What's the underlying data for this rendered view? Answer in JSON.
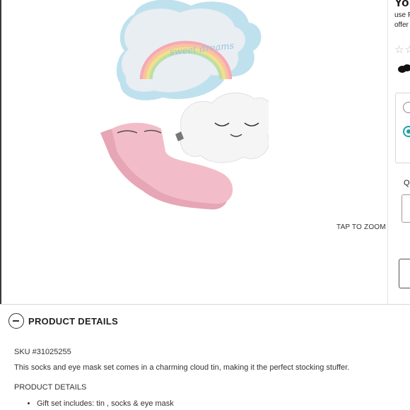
{
  "gallery": {
    "tin_lid_text": "sweet dreams",
    "tap_to_zoom": "TAP TO ZOOM"
  },
  "summary": {
    "title": "Yo",
    "line1": "use F",
    "line2": "offer",
    "stars": "☆☆",
    "qty_label": "Q"
  },
  "details": {
    "header": "PRODUCT DETAILS",
    "sku": "SKU #31025255",
    "description": "This socks and eye mask set comes in a charming cloud tin, making it the perfect stocking stuffer.",
    "subheader": "PRODUCT DETAILS",
    "bullets": [
      "Gift set includes: tin , socks & eye mask"
    ]
  },
  "colors": {
    "accent": "#1aa3a8",
    "border": "#d9d9d9"
  }
}
